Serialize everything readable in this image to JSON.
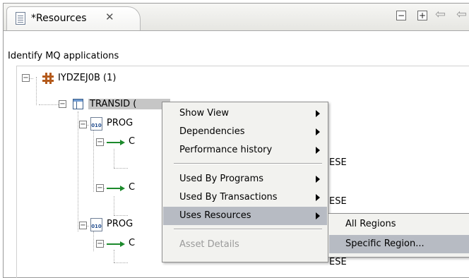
{
  "view": {
    "tab_title": "*Resources",
    "close_glyph": "✕",
    "collapse_icon": "−",
    "expand_icon": "+",
    "subtitle": "Identify MQ applications"
  },
  "tree": {
    "region": "IYDZEJ0B  (1)",
    "transaction": "TRANSID (",
    "program_1": "PROG",
    "program_2": "PROG",
    "child_1": "C",
    "child_2": "C",
    "child_3": "C",
    "clipped_1": "ESE",
    "clipped_2": "ESE",
    "clipped_3": "ESE"
  },
  "context_menu": {
    "items": [
      {
        "label": "Show View",
        "has_submenu": true
      },
      {
        "label": "Dependencies",
        "has_submenu": true
      },
      {
        "label": "Performance history",
        "has_submenu": true
      },
      {
        "label": "Used By Programs",
        "has_submenu": true
      },
      {
        "label": "Used By Transactions",
        "has_submenu": true
      },
      {
        "label": "Uses Resources",
        "has_submenu": true,
        "active": true
      },
      {
        "label": "Asset Details",
        "disabled": true
      }
    ],
    "submenu": [
      {
        "label": "All Regions"
      },
      {
        "label": "Specific Region...",
        "active": true
      }
    ]
  },
  "colors": {
    "highlight": "#b7bbc3",
    "menu_background": "#f2f2ef"
  }
}
